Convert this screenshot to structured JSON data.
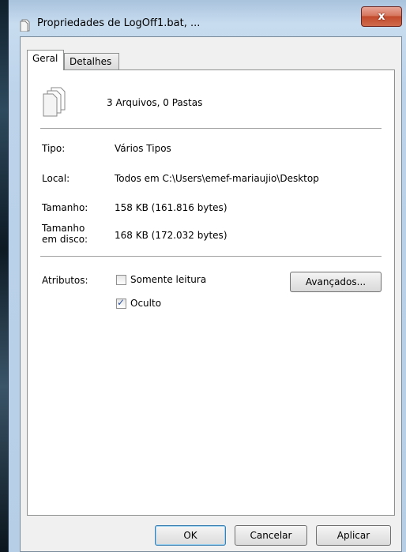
{
  "window": {
    "title": "Propriedades de LogOff1.bat, ...",
    "close_label": "x"
  },
  "tabs": [
    {
      "label": "Geral",
      "active": true
    },
    {
      "label": "Detalhes",
      "active": false
    }
  ],
  "general": {
    "summary": "3 Arquivos, 0 Pastas",
    "rows": [
      {
        "label": "Tipo:",
        "value": "Vários Tipos"
      },
      {
        "label": "Local:",
        "value": "Todos em C:\\Users\\emef-mariaujio\\Desktop"
      },
      {
        "label": "Tamanho:",
        "value": "158 KB (161.816 bytes)"
      },
      {
        "label_line1": "Tamanho",
        "label_line2": "em disco:",
        "value": "168 KB (172.032 bytes)"
      }
    ],
    "attributes_label": "Atributos:",
    "readonly_label": "Somente leitura",
    "readonly_checked": false,
    "hidden_label": "Oculto",
    "hidden_checked": true,
    "advanced_button": "Avançados..."
  },
  "buttons": {
    "ok": "OK",
    "cancel": "Cancelar",
    "apply": "Aplicar"
  },
  "colors": {
    "accent": "#3c7fb1",
    "close_red": "#c24a2c"
  },
  "icons": {
    "title": "document-icon",
    "files": "multiple-files-icon"
  }
}
